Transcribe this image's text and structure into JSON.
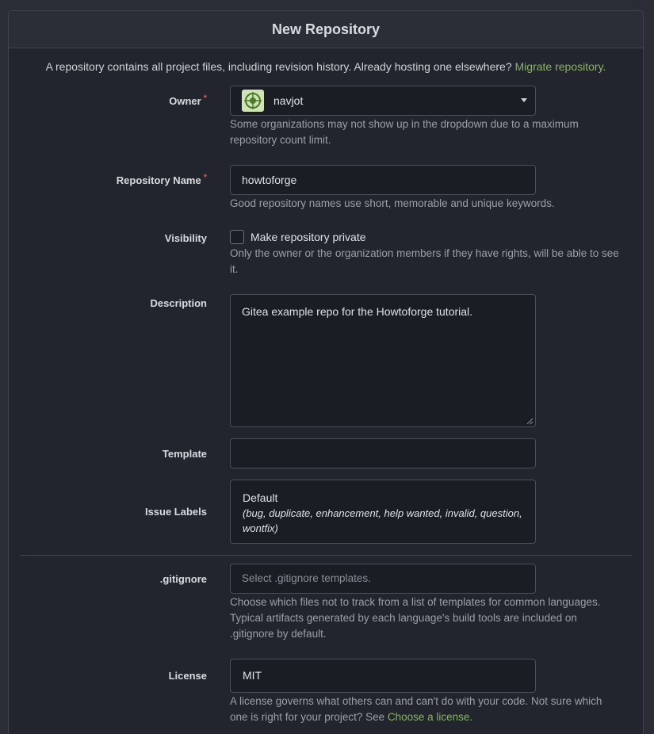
{
  "title": "New Repository",
  "intro": {
    "text": "A repository contains all project files, including revision history. Already hosting one elsewhere? ",
    "link": "Migrate repository."
  },
  "owner": {
    "label": "Owner",
    "value": "navjot",
    "help": "Some organizations may not show up in the dropdown due to a maximum repository count limit."
  },
  "repo_name": {
    "label": "Repository Name",
    "value": "howtoforge",
    "help": "Good repository names use short, memorable and unique keywords."
  },
  "visibility": {
    "label": "Visibility",
    "checkbox_label": "Make repository private",
    "help": "Only the owner or the organization members if they have rights, will be able to see it."
  },
  "description": {
    "label": "Description",
    "value": "Gitea example repo for the Howtoforge tutorial."
  },
  "template": {
    "label": "Template",
    "value": ""
  },
  "issue_labels": {
    "label": "Issue Labels",
    "value": "Default",
    "detail": "(bug, duplicate, enhancement, help wanted, invalid, question, wontfix)"
  },
  "gitignore": {
    "label": ".gitignore",
    "placeholder": "Select .gitignore templates.",
    "help": "Choose which files not to track from a list of templates for common languages. Typical artifacts generated by each language's build tools are included on .gitignore by default."
  },
  "license": {
    "label": "License",
    "value": "MIT",
    "help_text": "A license governs what others can and can't do with your code. Not sure which one is right for your project? See ",
    "help_link": "Choose a license."
  },
  "colors": {
    "accent": "#8ab36a",
    "required": "#d9534f",
    "background": "#22252d",
    "input_bg": "#1a1d24"
  }
}
